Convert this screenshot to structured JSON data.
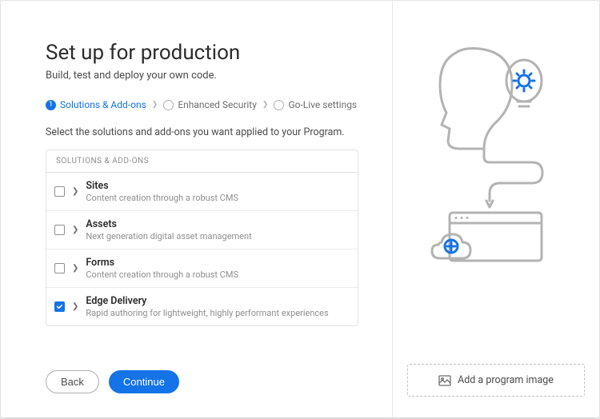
{
  "header": {
    "title": "Set up for production",
    "subtitle": "Build, test and deploy your own code."
  },
  "wizard": {
    "steps": [
      {
        "num": "1",
        "label": "Solutions & Add-ons"
      },
      {
        "num": "",
        "label": "Enhanced Security"
      },
      {
        "num": "",
        "label": "Go-Live settings"
      }
    ]
  },
  "instruction": "Select the solutions and add-ons you want applied to your Program.",
  "list": {
    "heading": "SOLUTIONS & ADD-ONS",
    "items": [
      {
        "title": "Sites",
        "desc": "Content creation through a robust CMS",
        "checked": false
      },
      {
        "title": "Assets",
        "desc": "Next generation digital asset management",
        "checked": false
      },
      {
        "title": "Forms",
        "desc": "Content creation through a robust CMS",
        "checked": false
      },
      {
        "title": "Edge Delivery",
        "desc": "Rapid authoring for lightweight, highly performant experiences",
        "checked": true
      }
    ]
  },
  "buttons": {
    "back": "Back",
    "continue": "Continue"
  },
  "upload": {
    "label": "Add a program image"
  }
}
